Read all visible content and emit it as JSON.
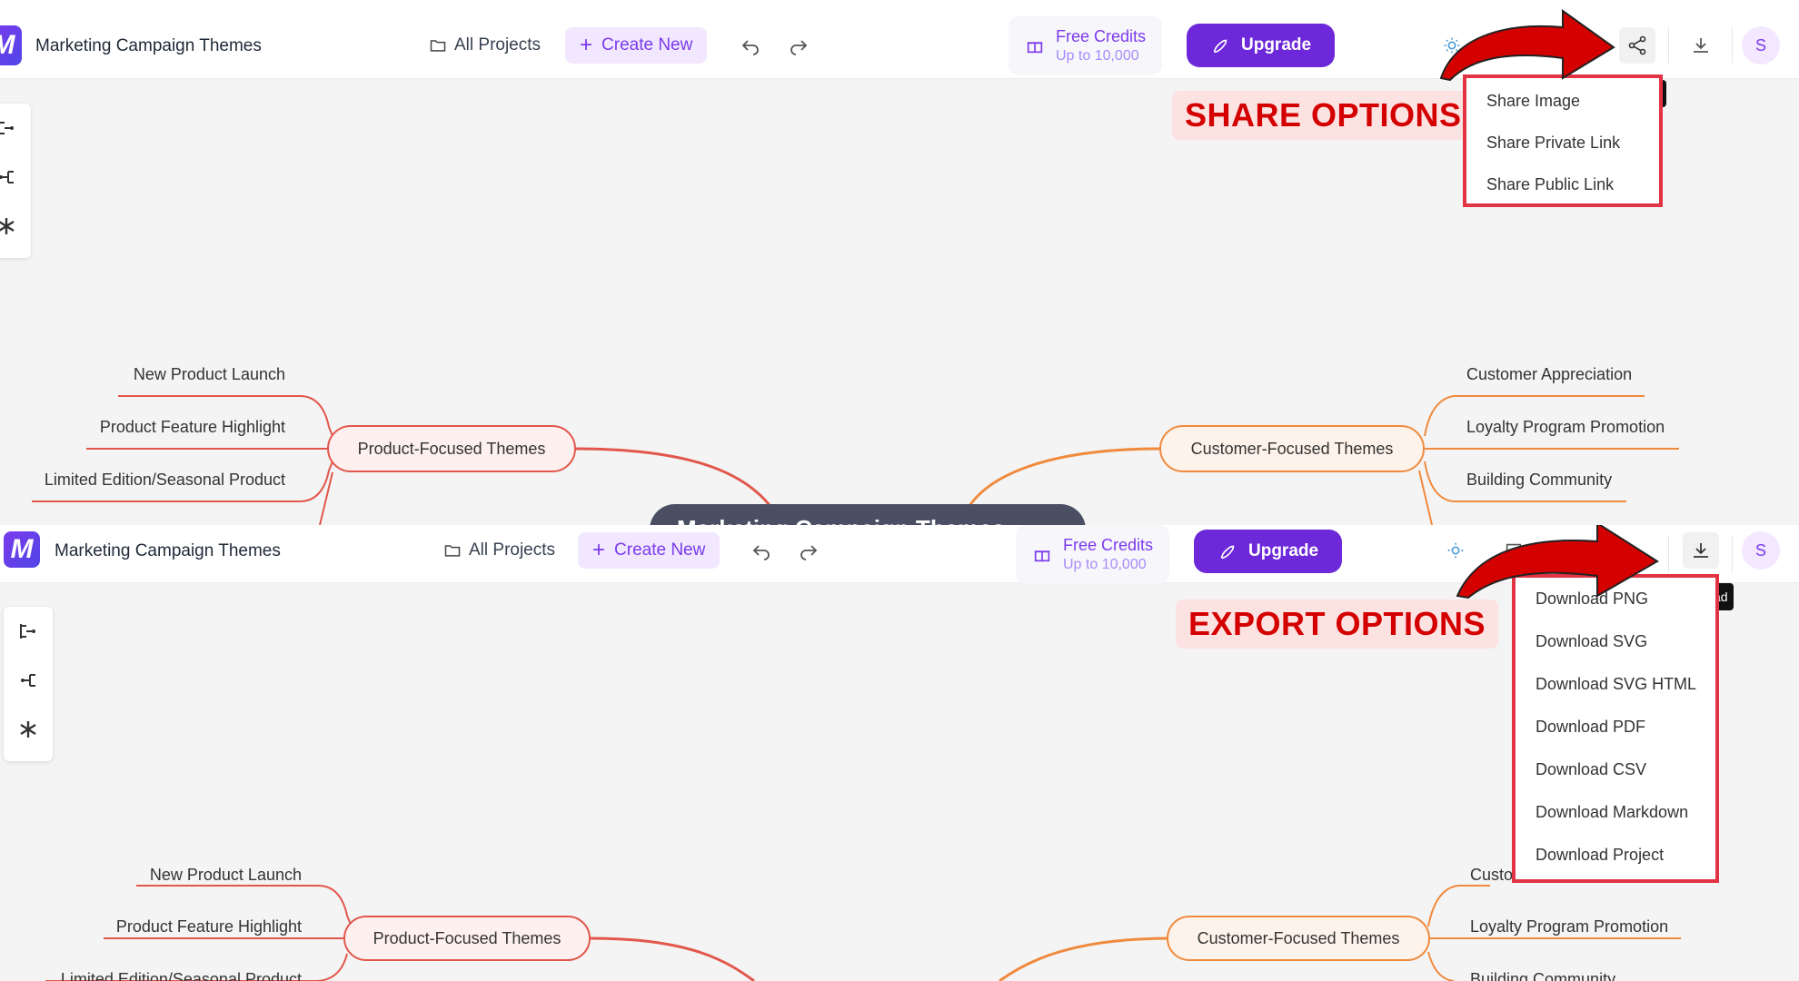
{
  "app": {
    "title": "Marketing Campaign Themes",
    "logo_text": "M",
    "accent_color": "#6d28d9"
  },
  "toolbar": {
    "all_projects": "All Projects",
    "create_new": "Create New",
    "credits_title": "Free Credits",
    "credits_sub": "Up to 10,000",
    "upgrade": "Upgrade",
    "avatar_initial": "S"
  },
  "share_panel": {
    "callout": "SHARE OPTIONS",
    "menu": [
      "Share Image",
      "Share Private Link",
      "Share Public Link"
    ]
  },
  "export_panel": {
    "callout": "EXPORT OPTIONS",
    "tooltip_fragment": "ad",
    "menu": [
      "Download PNG",
      "Download SVG",
      "Download SVG HTML",
      "Download PDF",
      "Download CSV",
      "Download Markdown",
      "Download Project"
    ]
  },
  "mindmap": {
    "center": "Marketing Campaign Themes",
    "left_branch": {
      "label": "Product-Focused Themes",
      "color": "#e2574c",
      "leaves": [
        "New Product Launch",
        "Product Feature Highlight",
        "Limited Edition/Seasonal Product"
      ]
    },
    "right_branch": {
      "label": "Customer-Focused Themes",
      "color": "#f08a3e",
      "leaves": [
        "Customer Appreciation",
        "Loyalty Program Promotion",
        "Building Community"
      ]
    },
    "partial_leaf_bottom": "Custo"
  },
  "annotation_colors": {
    "arrow": "#d40000",
    "highlight_border": "#e23344"
  }
}
